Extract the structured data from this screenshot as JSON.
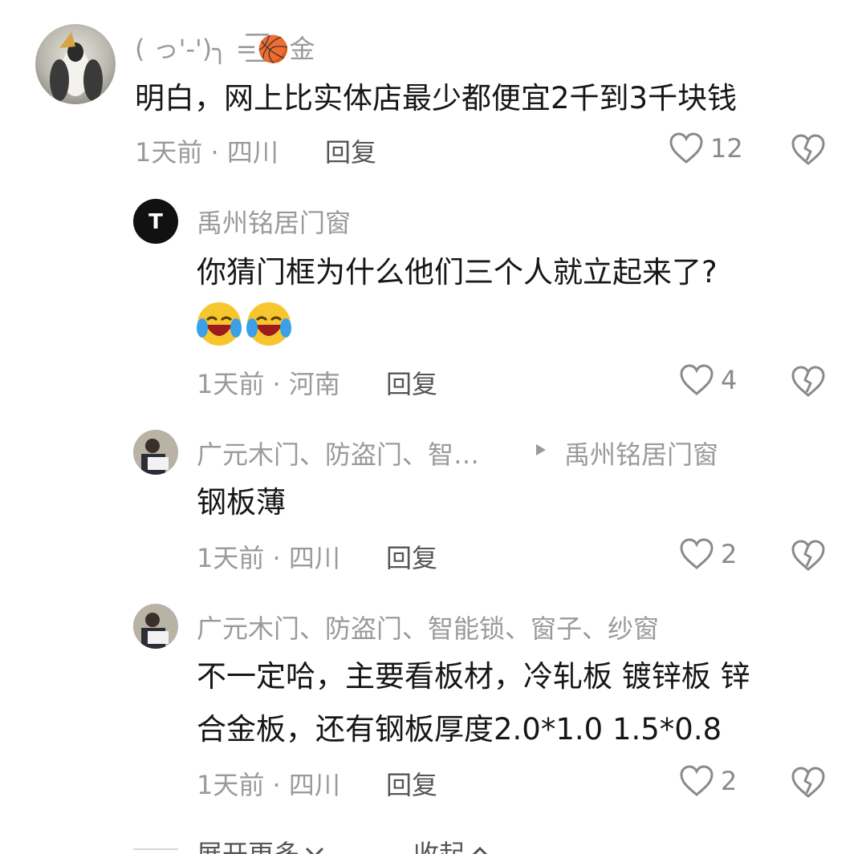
{
  "comments": [
    {
      "author": "( っ'-')╮ =͟͟͞͞🏀金",
      "text": "明白，网上比实体店最少都便宜2千到3千块钱",
      "time_location": "1天前 · 四川",
      "reply_label": "回复",
      "likes": "12"
    },
    {
      "author": "禹州铭居门窗",
      "text": "你猜门框为什么他们三个人就立起来了?",
      "emojis": [
        "crying-laugh-emoji",
        "crying-laugh-emoji"
      ],
      "time_location": "1天前 · 河南",
      "reply_label": "回复",
      "likes": "4"
    },
    {
      "author": "广元木门、防盗门、智…",
      "reply_to": "禹州铭居门窗",
      "text": "钢板薄",
      "time_location": "1天前 · 四川",
      "reply_label": "回复",
      "likes": "2"
    },
    {
      "author": "广元木门、防盗门、智能锁、窗子、纱窗",
      "text_line1": "不一定哈，主要看板材，冷轧板  镀锌板  锌",
      "text_line2": "合金板，还有钢板厚度2.0*1.0   1.5*0.8",
      "time_location": "1天前 · 四川",
      "reply_label": "回复",
      "likes": "2"
    }
  ],
  "footer": {
    "expand_label": "展开更多",
    "collapse_label": "收起"
  },
  "colors": {
    "text": "#161616",
    "muted": "#9a9a9a"
  }
}
